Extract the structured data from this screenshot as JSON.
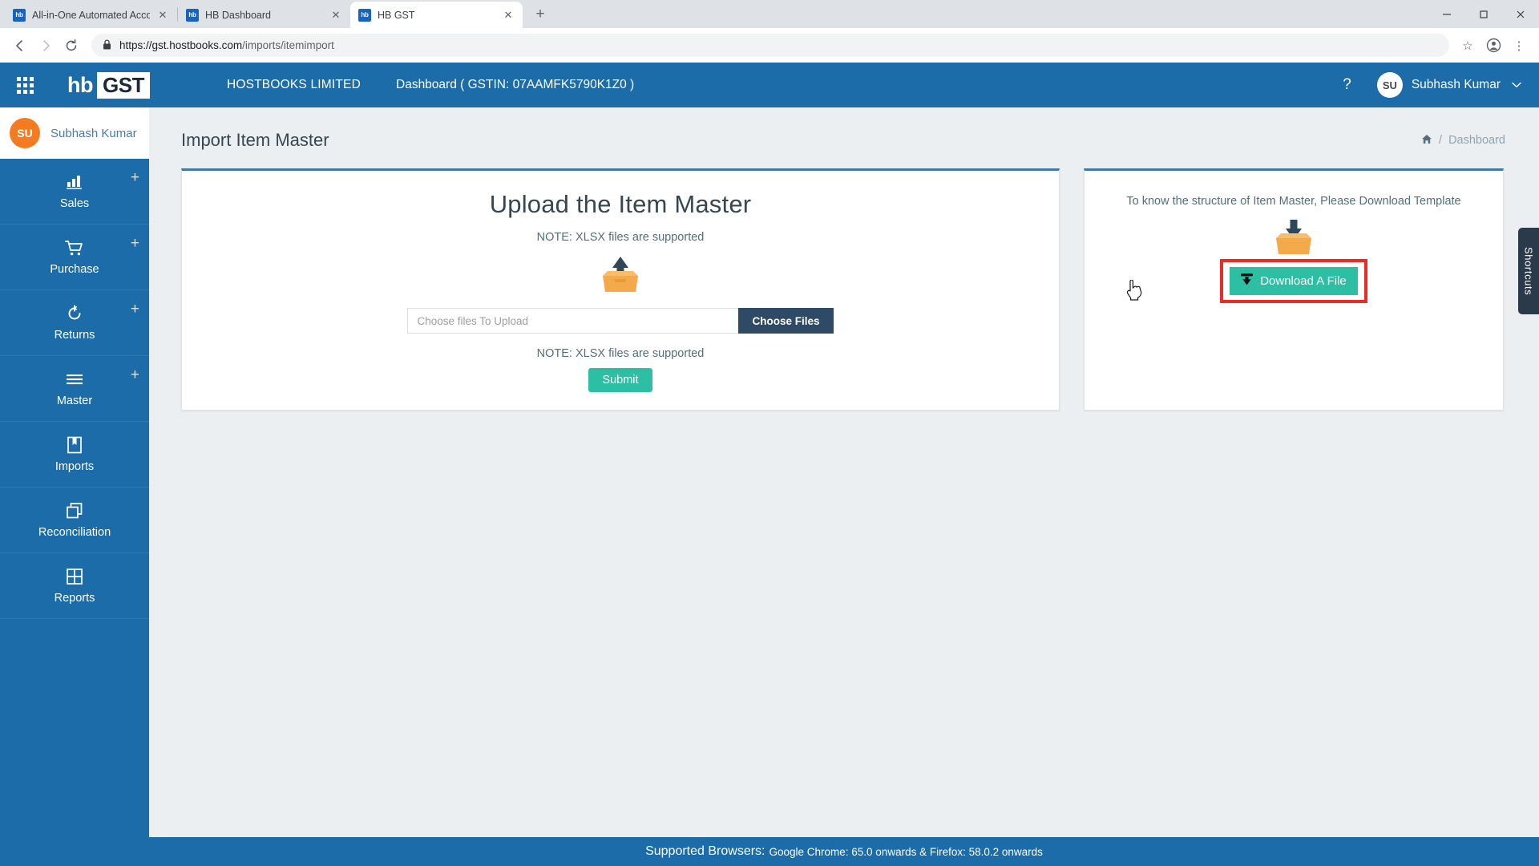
{
  "browser": {
    "tabs": [
      {
        "favicon": "hb",
        "title": "All-in-One Automated Accountin",
        "active": false
      },
      {
        "favicon": "hb",
        "title": "HB Dashboard",
        "active": false
      },
      {
        "favicon": "hb",
        "title": "HB GST",
        "active": true
      }
    ],
    "new_tab_label": "+",
    "window_controls": {
      "minimize": "—",
      "maximize": "❐",
      "close": "✕"
    },
    "nav": {
      "back": "←",
      "forward": "→",
      "reload": "⟳"
    },
    "url": {
      "scheme_host": "https://gst.hostbooks.com",
      "path": "/imports/itemimport",
      "lock_icon": "lock-icon"
    },
    "omni_icons": {
      "bookmark": "☆",
      "profile": "●",
      "menu": "⋮"
    }
  },
  "topbar": {
    "apps_icon": "grid-apps-icon",
    "brand_hb": "hb",
    "brand_gst": "GST",
    "company": "HOSTBOOKS LIMITED",
    "dashboard_info": "Dashboard ( GSTIN: 07AAMFK5790K1Z0 )",
    "help_label": "?",
    "user_initials": "SU",
    "user_name": "Subhash Kumar",
    "caret": "⌄"
  },
  "sidebar": {
    "user_initials": "SU",
    "user_name": "Subhash Kumar",
    "plus_label": "+",
    "items": [
      {
        "label": "Sales",
        "icon": "bar-chart-icon",
        "has_plus": true
      },
      {
        "label": "Purchase",
        "icon": "shopping-cart-icon",
        "has_plus": true
      },
      {
        "label": "Returns",
        "icon": "refresh-cycle-icon",
        "has_plus": true
      },
      {
        "label": "Master",
        "icon": "hamburger-lines-icon",
        "has_plus": true
      },
      {
        "label": "Imports",
        "icon": "bookmark-book-icon",
        "has_plus": false
      },
      {
        "label": "Reconciliation",
        "icon": "copy-layers-icon",
        "has_plus": false
      },
      {
        "label": "Reports",
        "icon": "grid-table-icon",
        "has_plus": false
      }
    ]
  },
  "page": {
    "title": "Import Item Master",
    "breadcrumb": {
      "home_icon": "home-icon",
      "separator": "/",
      "current": "Dashboard"
    }
  },
  "upload_card": {
    "heading": "Upload the Item Master",
    "note_top": "NOTE: XLSX files are supported",
    "upload_icon": "upload-box-icon",
    "file_placeholder": "Choose files To Upload",
    "file_value": "",
    "choose_files_label": "Choose Files",
    "note_bottom": "NOTE: XLSX files are supported",
    "submit_label": "Submit"
  },
  "download_card": {
    "note": "To know the structure of Item Master, Please Download Template",
    "download_icon": "download-box-icon",
    "button_label": "Download A File",
    "button_icon": "download-arrow-icon",
    "highlighted": true,
    "cursor": "pointer-hand-cursor"
  },
  "shortcuts_tab": {
    "label": "Shortcuts"
  },
  "footer": {
    "strong": "Supported Browsers:",
    "rest": "Google Chrome: 65.0 onwards & Firefox: 58.0.2 onwards"
  },
  "colors": {
    "brand_blue": "#1b6ca8",
    "accent_teal": "#2dbfa4",
    "avatar_orange": "#f47b20",
    "highlight_red": "#ee2b22",
    "dark_navy": "#2f4a66"
  }
}
